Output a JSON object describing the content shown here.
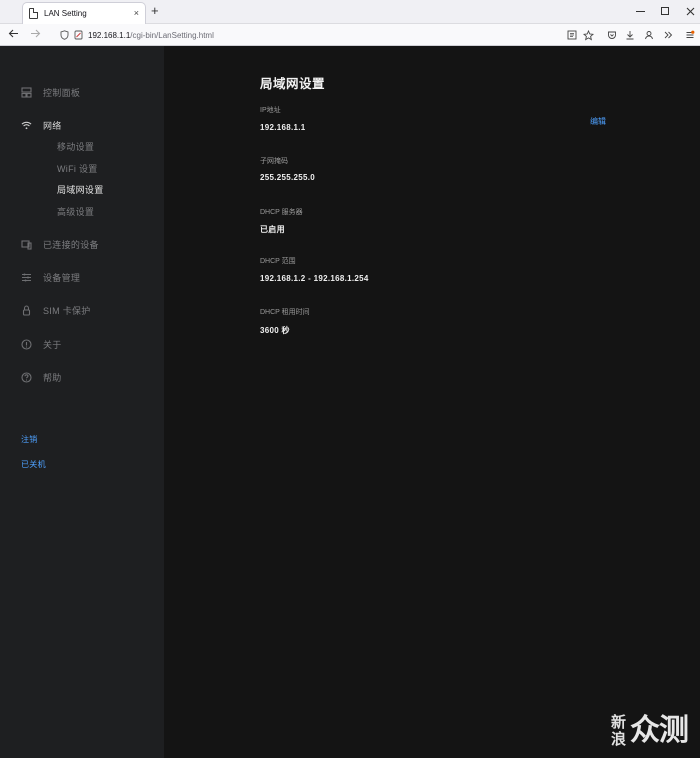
{
  "browser": {
    "tab_title": "LAN Setting",
    "tab_close": "×",
    "new_tab": "+",
    "url_host": "192.168.1.1",
    "url_path": "/cgi-bin/LanSetting.html"
  },
  "sidebar": {
    "items": [
      {
        "label": "控制面板",
        "icon": "dashboard-icon"
      },
      {
        "label": "网络",
        "icon": "wifi-icon",
        "active": true
      },
      {
        "label": "已连接的设备",
        "icon": "devices-icon"
      },
      {
        "label": "设备管理",
        "icon": "settings-sliders-icon"
      },
      {
        "label": "SIM 卡保护",
        "icon": "lock-icon"
      },
      {
        "label": "关于",
        "icon": "info-icon"
      },
      {
        "label": "帮助",
        "icon": "help-icon"
      }
    ],
    "network_sub": [
      {
        "label": "移动设置"
      },
      {
        "label": "WiFi 设置"
      },
      {
        "label": "局域网设置",
        "active": true
      },
      {
        "label": "高级设置"
      }
    ],
    "logout": "注销",
    "shutdown": "已关机"
  },
  "main": {
    "title": "局域网设置",
    "edit": "编辑",
    "fields": [
      {
        "label": "IP地址",
        "value": "192.168.1.1"
      },
      {
        "label": "子网掩码",
        "value": "255.255.255.0"
      },
      {
        "label": "DHCP 服务器",
        "value": "已启用"
      },
      {
        "label": "DHCP 范围",
        "value": "192.168.1.2 - 192.168.1.254"
      },
      {
        "label": "DHCP 租用时间",
        "value": "3600 秒"
      }
    ]
  },
  "watermark": {
    "small_top": "新",
    "small_bottom": "浪",
    "big": "众测"
  }
}
